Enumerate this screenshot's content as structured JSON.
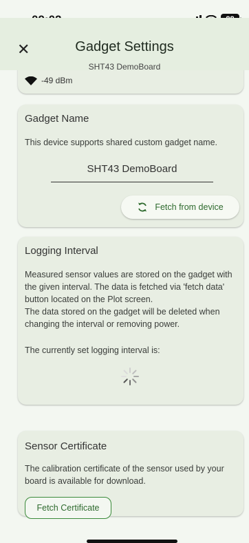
{
  "status_bar": {
    "time": "09:02",
    "battery": "88"
  },
  "header": {
    "title": "Gadget Settings",
    "subtitle": "SHT43 DemoBoard"
  },
  "signal": {
    "rssi": "-49 dBm"
  },
  "gadget_name": {
    "heading": "Gadget Name",
    "description": "This device supports shared custom gadget name.",
    "value": "SHT43 DemoBoard",
    "fetch_button": "Fetch from device"
  },
  "logging": {
    "heading": "Logging Interval",
    "description": "Measured sensor values are stored on the gadget with the given interval. The data is fetched via 'fetch data' button located on the Plot screen.",
    "note": "The data stored on the gadget will be deleted when changing the interval or removing power.",
    "current_label": "The currently set logging interval is:"
  },
  "certificate": {
    "heading": "Sensor Certificate",
    "description": "The calibration certificate of the sensor used by your board is available for download.",
    "button": "Fetch Certificate"
  },
  "colors": {
    "accent": "#2e6a2e",
    "card": "#e8eee3",
    "header": "#e5eee0"
  }
}
